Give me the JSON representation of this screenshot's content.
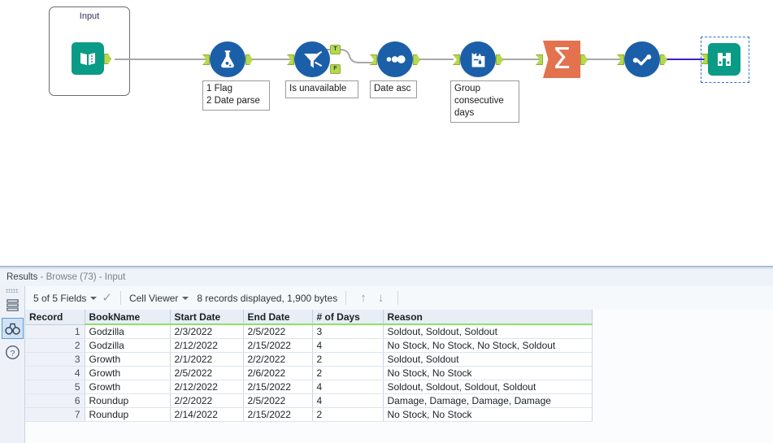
{
  "canvas": {
    "container": {
      "title": "Input"
    },
    "tools": [
      {
        "id": "input",
        "icon": "book-input-icon",
        "label": ""
      },
      {
        "id": "formula",
        "icon": "flask-formula-icon",
        "label": "1 Flag\n2 Date parse"
      },
      {
        "id": "filter",
        "icon": "funnel-filter-icon",
        "label": "Is unavailable",
        "out_true": "T",
        "out_false": "F"
      },
      {
        "id": "sort",
        "icon": "sort-dots-icon",
        "label": "Date asc"
      },
      {
        "id": "multirow",
        "icon": "multirow-formula-icon",
        "label": "Group\nconsecutive\ndays"
      },
      {
        "id": "summarize",
        "icon": "sigma-summarize-icon",
        "label": "",
        "glyph": "Σ"
      },
      {
        "id": "select",
        "icon": "check-select-icon",
        "label": ""
      },
      {
        "id": "browse",
        "icon": "binoculars-browse-icon",
        "label": "",
        "selected": true
      }
    ],
    "colors": {
      "tool_blue": "#1b5fa8",
      "tool_teal": "#0a9b86",
      "tool_orange": "#e3724f",
      "anchor_green": "#b5d94c",
      "wire_gray": "#a8a8a8",
      "wire_selected": "#3b1fd0",
      "selection_dash": "#2d6fd6"
    }
  },
  "results": {
    "title_prefix": "Results",
    "title_rest": " - Browse (73) - Input",
    "rail": [
      {
        "name": "records-layers-icon",
        "active": false
      },
      {
        "name": "binoculars-browse-icon",
        "active": true
      },
      {
        "name": "help-question-icon",
        "active": false
      }
    ],
    "toolbar": {
      "fields_label": "5 of 5 Fields",
      "check_icon": "checkmark-icon",
      "view_label": "Cell Viewer",
      "records_label": "8 records displayed, 1,900 bytes",
      "up_arrow": "↑",
      "down_arrow": "↓"
    },
    "grid": {
      "columns": [
        "Record",
        "BookName",
        "Start Date",
        "End Date",
        "# of Days",
        "Reason"
      ],
      "rows": [
        {
          "record": "1",
          "book": "Godzilla",
          "start": "2/3/2022",
          "end": "2/5/2022",
          "days": "3",
          "reason": "Soldout, Soldout, Soldout"
        },
        {
          "record": "2",
          "book": "Godzilla",
          "start": "2/12/2022",
          "end": "2/15/2022",
          "days": "4",
          "reason": "No Stock, No Stock, No Stock, Soldout"
        },
        {
          "record": "3",
          "book": "Growth",
          "start": "2/1/2022",
          "end": "2/2/2022",
          "days": "2",
          "reason": "Soldout, Soldout"
        },
        {
          "record": "4",
          "book": "Growth",
          "start": "2/5/2022",
          "end": "2/6/2022",
          "days": "2",
          "reason": "No Stock, No Stock"
        },
        {
          "record": "5",
          "book": "Growth",
          "start": "2/12/2022",
          "end": "2/15/2022",
          "days": "4",
          "reason": "Soldout, Soldout, Soldout, Soldout"
        },
        {
          "record": "6",
          "book": "Roundup",
          "start": "2/2/2022",
          "end": "2/5/2022",
          "days": "4",
          "reason": "Damage, Damage, Damage, Damage"
        },
        {
          "record": "7",
          "book": "Roundup",
          "start": "2/14/2022",
          "end": "2/15/2022",
          "days": "2",
          "reason": "No Stock, No Stock"
        }
      ]
    }
  }
}
